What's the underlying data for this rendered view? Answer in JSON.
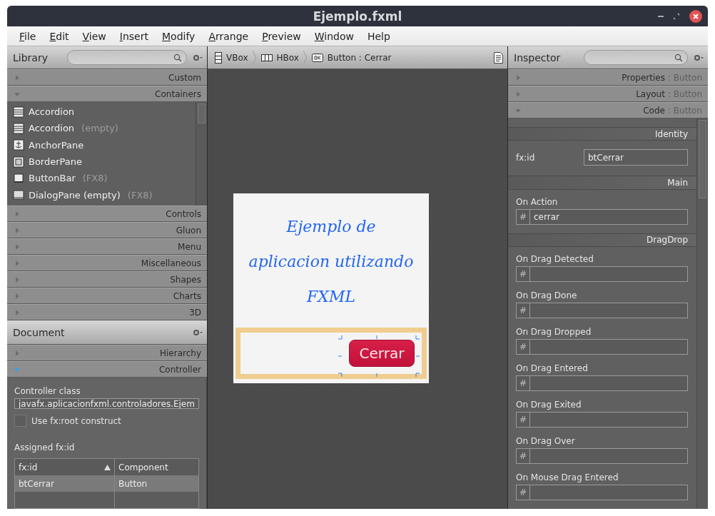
{
  "window": {
    "title": "Ejemplo.fxml"
  },
  "menu": [
    {
      "label": "File",
      "mnemonic": true
    },
    {
      "label": "Edit",
      "mnemonic": true
    },
    {
      "label": "View",
      "mnemonic": true
    },
    {
      "label": "Insert",
      "mnemonic": true
    },
    {
      "label": "Modify",
      "mnemonic": true
    },
    {
      "label": "Arrange",
      "mnemonic": true
    },
    {
      "label": "Preview",
      "mnemonic": true
    },
    {
      "label": "Window",
      "mnemonic": true
    },
    {
      "label": "Help",
      "mnemonic": false
    }
  ],
  "library": {
    "title": "Library",
    "sections": [
      {
        "label": "Custom",
        "expanded": false
      },
      {
        "label": "Containers",
        "expanded": true,
        "items": [
          {
            "name": "Accordion"
          },
          {
            "name": "Accordion",
            "tag": "(empty)"
          },
          {
            "name": "AnchorPane"
          },
          {
            "name": "BorderPane"
          },
          {
            "name": "ButtonBar",
            "tag": "(FX8)"
          },
          {
            "name": "DialogPane (empty)",
            "tag": "(FX8)"
          }
        ]
      },
      {
        "label": "Controls",
        "expanded": false
      },
      {
        "label": "Gluon",
        "expanded": false
      },
      {
        "label": "Menu",
        "expanded": false
      },
      {
        "label": "Miscellaneous",
        "expanded": false
      },
      {
        "label": "Shapes",
        "expanded": false
      },
      {
        "label": "Charts",
        "expanded": false
      },
      {
        "label": "3D",
        "expanded": false
      }
    ]
  },
  "document": {
    "title": "Document",
    "sections": [
      {
        "label": "Hierarchy",
        "expanded": false
      },
      {
        "label": "Controller",
        "expanded": true
      }
    ],
    "controller_class_label": "Controller class",
    "controller_class": "javafx.aplicacionfxml.controladores.Ejem",
    "root_construct": {
      "label": "Use fx:root construct",
      "checked": false
    },
    "assigned_label": "Assigned fx:id",
    "table": {
      "columns": [
        "fx:id",
        "Component"
      ],
      "rows": [
        {
          "cells": [
            "btCerrar",
            "Button"
          ],
          "selected": true
        }
      ]
    }
  },
  "breadcrumb": [
    {
      "label": "VBox"
    },
    {
      "label": "HBox"
    },
    {
      "label": "Button : Cerrar"
    }
  ],
  "preview": {
    "heading": [
      "Ejemplo de",
      "aplicacion utilizando",
      "FXML"
    ],
    "button": "Cerrar"
  },
  "inspector": {
    "title": "Inspector",
    "sections": [
      {
        "title": "Properties",
        "subtitle": ": Button",
        "expanded": false
      },
      {
        "title": "Layout",
        "subtitle": ": Button",
        "expanded": false
      },
      {
        "title": "Code",
        "subtitle": ": Button",
        "expanded": true
      }
    ],
    "groups": [
      {
        "title": "Identity",
        "fields": [
          {
            "kind": "inline",
            "label": "fx:id",
            "value": "btCerrar"
          }
        ]
      },
      {
        "title": "Main",
        "fields": [
          {
            "kind": "handler",
            "label": "On Action",
            "prefix": "#",
            "value": "cerrar"
          }
        ]
      },
      {
        "title": "DragDrop",
        "fields": [
          {
            "kind": "handler",
            "label": "On Drag Detected",
            "prefix": "#"
          },
          {
            "kind": "handler",
            "label": "On Drag Done",
            "prefix": "#"
          },
          {
            "kind": "handler",
            "label": "On Drag Dropped",
            "prefix": "#"
          },
          {
            "kind": "handler",
            "label": "On Drag Entered",
            "prefix": "#"
          },
          {
            "kind": "handler",
            "label": "On Drag Exited",
            "prefix": "#"
          },
          {
            "kind": "handler",
            "label": "On Drag Over",
            "prefix": "#"
          },
          {
            "kind": "handler",
            "label": "On Mouse Drag Entered",
            "prefix": "#"
          }
        ]
      }
    ]
  }
}
